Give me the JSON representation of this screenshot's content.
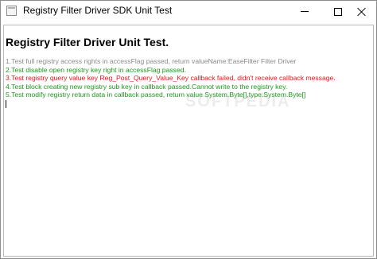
{
  "window": {
    "title": "Registry Filter Driver SDK Unit Test",
    "app_icon": "app-window-icon",
    "controls": {
      "minimize_icon": "minimize-icon",
      "maximize_icon": "maximize-icon",
      "close_icon": "close-icon"
    }
  },
  "content": {
    "heading": "Registry Filter Driver Unit Test.",
    "log_lines": [
      {
        "text": "1.Test full registry access rights in accessFlag passed, return valueName:EaseFilter Filter Driver",
        "color": "#8a8a8a"
      },
      {
        "text": "2.Test disable open registry key right in accessFlag passed.",
        "color": "#1a9a1a"
      },
      {
        "text": "3.Test registry query value key Reg_Post_Query_Value_Key callback failed, didn't receive callback message.",
        "color": "#e01818"
      },
      {
        "text": "4.Test block creating new registry sub key in callback passed.Cannot write to the registry key.",
        "color": "#1a9a1a"
      },
      {
        "text": "5.Test modify registry return data in callback passed, return value System.Byte[],type:System.Byte[]",
        "color": "#1a9a1a"
      }
    ],
    "watermark": "SOFTPEDIA"
  }
}
